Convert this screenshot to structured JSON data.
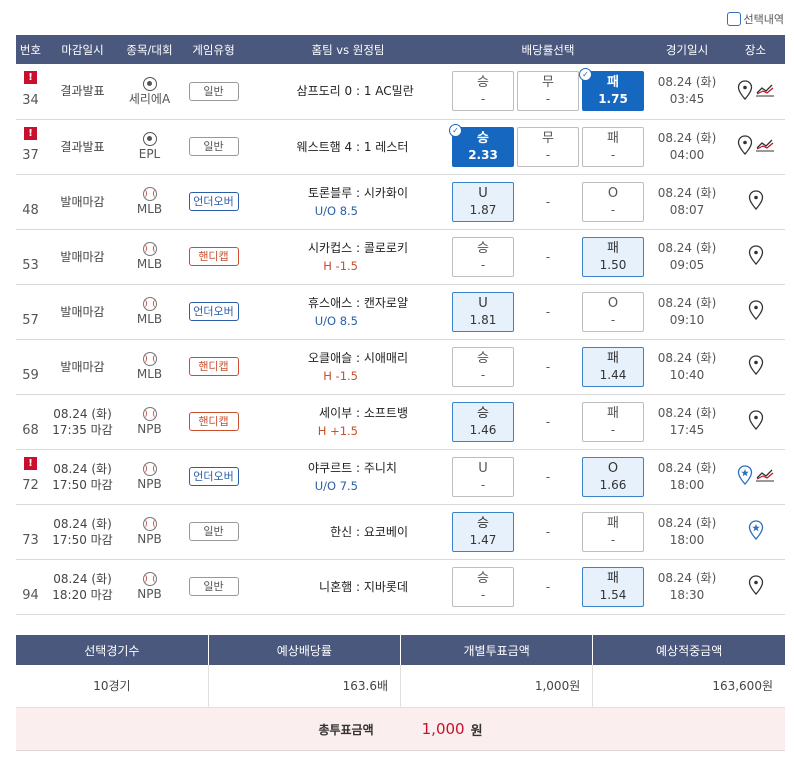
{
  "top_checkbox_label": "선택내역",
  "columns": [
    "번호",
    "마감일시",
    "종목/대회",
    "게임유형",
    "홈팀 vs 원정팀",
    "배당률선택",
    "경기일시",
    "장소"
  ],
  "rows": [
    {
      "no": "34",
      "alert": true,
      "close1": "결과발표",
      "close2": "",
      "sport": "soccer",
      "league": "세리에A",
      "type": "일반",
      "type_kind": "normal",
      "home": "삼프도리 0",
      "away": "1 AC밀란",
      "sub": "",
      "sub_kind": "",
      "o1": {
        "label": "승",
        "val": "-",
        "state": "normal"
      },
      "o2": {
        "label": "무",
        "val": "-",
        "state": "normal",
        "dash": false
      },
      "o3": {
        "label": "패",
        "val": "1.75",
        "state": "sel"
      },
      "date": "08.24 (화)",
      "time": "03:45",
      "trend": true,
      "star": false
    },
    {
      "no": "37",
      "alert": true,
      "close1": "결과발표",
      "close2": "",
      "sport": "soccer",
      "league": "EPL",
      "type": "일반",
      "type_kind": "normal",
      "home": "웨스트햄 4",
      "away": "1 레스터",
      "sub": "",
      "sub_kind": "",
      "o1": {
        "label": "승",
        "val": "2.33",
        "state": "sel"
      },
      "o2": {
        "label": "무",
        "val": "-",
        "state": "normal",
        "dash": false
      },
      "o3": {
        "label": "패",
        "val": "-",
        "state": "normal"
      },
      "date": "08.24 (화)",
      "time": "04:00",
      "trend": true,
      "star": false
    },
    {
      "no": "48",
      "alert": false,
      "close1": "발매마감",
      "close2": "",
      "sport": "baseball",
      "league": "MLB",
      "type": "언더오버",
      "type_kind": "overunder",
      "home": "토론블루",
      "away": "시카화이",
      "sub": "U/O 8.5",
      "sub_kind": "ou",
      "o1": {
        "label": "U",
        "val": "1.87",
        "state": "hl"
      },
      "o2": {
        "label": "",
        "val": "-",
        "state": "normal",
        "dash": true
      },
      "o3": {
        "label": "O",
        "val": "-",
        "state": "normal"
      },
      "date": "08.24 (화)",
      "time": "08:07",
      "trend": false,
      "star": false
    },
    {
      "no": "53",
      "alert": false,
      "close1": "발매마감",
      "close2": "",
      "sport": "baseball",
      "league": "MLB",
      "type": "핸디캡",
      "type_kind": "handicap",
      "home": "시카컵스",
      "away": "콜로로키",
      "sub": "H -1.5",
      "sub_kind": "hc",
      "o1": {
        "label": "승",
        "val": "-",
        "state": "normal"
      },
      "o2": {
        "label": "",
        "val": "-",
        "state": "normal",
        "dash": true
      },
      "o3": {
        "label": "패",
        "val": "1.50",
        "state": "hl"
      },
      "date": "08.24 (화)",
      "time": "09:05",
      "trend": false,
      "star": false
    },
    {
      "no": "57",
      "alert": false,
      "close1": "발매마감",
      "close2": "",
      "sport": "baseball",
      "league": "MLB",
      "type": "언더오버",
      "type_kind": "overunder",
      "home": "휴스애스",
      "away": "캔자로얄",
      "sub": "U/O 8.5",
      "sub_kind": "ou",
      "o1": {
        "label": "U",
        "val": "1.81",
        "state": "hl"
      },
      "o2": {
        "label": "",
        "val": "-",
        "state": "normal",
        "dash": true
      },
      "o3": {
        "label": "O",
        "val": "-",
        "state": "normal"
      },
      "date": "08.24 (화)",
      "time": "09:10",
      "trend": false,
      "star": false
    },
    {
      "no": "59",
      "alert": false,
      "close1": "발매마감",
      "close2": "",
      "sport": "baseball",
      "league": "MLB",
      "type": "핸디캡",
      "type_kind": "handicap",
      "home": "오클애슬",
      "away": "시애매리",
      "sub": "H -1.5",
      "sub_kind": "hc",
      "o1": {
        "label": "승",
        "val": "-",
        "state": "normal"
      },
      "o2": {
        "label": "",
        "val": "-",
        "state": "normal",
        "dash": true
      },
      "o3": {
        "label": "패",
        "val": "1.44",
        "state": "hl"
      },
      "date": "08.24 (화)",
      "time": "10:40",
      "trend": false,
      "star": false
    },
    {
      "no": "68",
      "alert": false,
      "close1": "08.24 (화)",
      "close2": "17:35 마감",
      "sport": "baseball",
      "league": "NPB",
      "type": "핸디캡",
      "type_kind": "handicap",
      "home": "세이부",
      "away": "소프트뱅",
      "sub": "H +1.5",
      "sub_kind": "hc",
      "o1": {
        "label": "승",
        "val": "1.46",
        "state": "hl"
      },
      "o2": {
        "label": "",
        "val": "-",
        "state": "normal",
        "dash": true
      },
      "o3": {
        "label": "패",
        "val": "-",
        "state": "normal"
      },
      "date": "08.24 (화)",
      "time": "17:45",
      "trend": false,
      "star": false
    },
    {
      "no": "72",
      "alert": true,
      "close1": "08.24 (화)",
      "close2": "17:50 마감",
      "sport": "baseball",
      "league": "NPB",
      "type": "언더오버",
      "type_kind": "overunder",
      "home": "야쿠르트",
      "away": "주니치",
      "sub": "U/O 7.5",
      "sub_kind": "ou",
      "o1": {
        "label": "U",
        "val": "-",
        "state": "normal"
      },
      "o2": {
        "label": "",
        "val": "-",
        "state": "normal",
        "dash": true
      },
      "o3": {
        "label": "O",
        "val": "1.66",
        "state": "hl"
      },
      "date": "08.24 (화)",
      "time": "18:00",
      "trend": true,
      "star": true
    },
    {
      "no": "73",
      "alert": false,
      "close1": "08.24 (화)",
      "close2": "17:50 마감",
      "sport": "baseball",
      "league": "NPB",
      "type": "일반",
      "type_kind": "normal",
      "home": "한신",
      "away": "요코베이",
      "sub": "",
      "sub_kind": "",
      "o1": {
        "label": "승",
        "val": "1.47",
        "state": "hl"
      },
      "o2": {
        "label": "",
        "val": "-",
        "state": "normal",
        "dash": true
      },
      "o3": {
        "label": "패",
        "val": "-",
        "state": "normal"
      },
      "date": "08.24 (화)",
      "time": "18:00",
      "trend": false,
      "star": true
    },
    {
      "no": "94",
      "alert": false,
      "close1": "08.24 (화)",
      "close2": "18:20 마감",
      "sport": "baseball",
      "league": "NPB",
      "type": "일반",
      "type_kind": "normal",
      "home": "니혼햄",
      "away": "지바롯데",
      "sub": "",
      "sub_kind": "",
      "o1": {
        "label": "승",
        "val": "-",
        "state": "normal"
      },
      "o2": {
        "label": "",
        "val": "-",
        "state": "normal",
        "dash": true
      },
      "o3": {
        "label": "패",
        "val": "1.54",
        "state": "hl"
      },
      "date": "08.24 (화)",
      "time": "18:30",
      "trend": false,
      "star": false
    }
  ],
  "summary": {
    "headers": [
      "선택경기수",
      "예상배당률",
      "개별투표금액",
      "예상적중금액"
    ],
    "values": [
      "10경기",
      "163.6배",
      "1,000원",
      "163,600원"
    ]
  },
  "total": {
    "label": "총투표금액",
    "amount": "1,000",
    "unit": "원"
  },
  "colors": {
    "header": "#4a587d",
    "selected": "#1567c0",
    "highlight": "#e7f1fb",
    "alert": "#c8102e",
    "handicap": "#c8502e",
    "overunder": "#2a5ea8"
  },
  "icons": {
    "venue": "map-pin-icon",
    "trend": "trend-chart-icon",
    "star": "star-pin-icon",
    "alert": "alert-icon"
  }
}
